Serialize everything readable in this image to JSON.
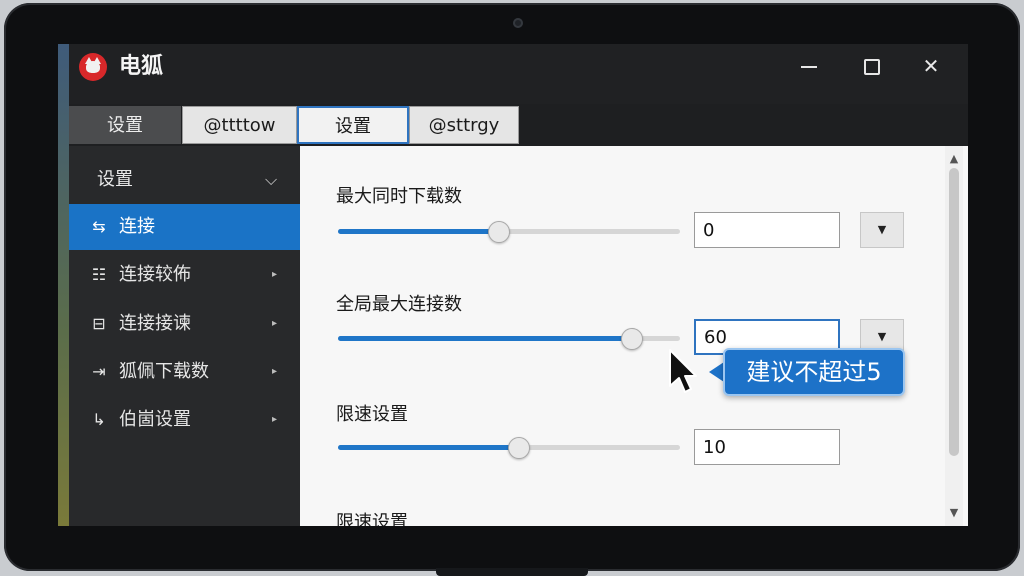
{
  "window": {
    "app_title": "电狐",
    "logo": "fox-logo",
    "controls": [
      "minimize-icon",
      "maximize-icon",
      "close-icon"
    ],
    "close_glyph": "✕"
  },
  "tabs": [
    {
      "label": "设置",
      "state": "dark"
    },
    {
      "label": "@ttttow",
      "state": "normal"
    },
    {
      "label": "设置",
      "state": "selected"
    },
    {
      "label": "@sttrgy",
      "state": "normal"
    }
  ],
  "sidebar": {
    "header": {
      "label": "设置",
      "chevron": "⌵"
    },
    "items": [
      {
        "label": "连接",
        "icon": "connection-icon",
        "glyph": "⇆",
        "active": true
      },
      {
        "label": "连接较佈",
        "icon": "list-icon",
        "glyph": "☷",
        "arrow": "▸"
      },
      {
        "label": "连接接谏",
        "icon": "box-icon",
        "glyph": "⊟",
        "arrow": "▸"
      },
      {
        "label": "狐佩下载数",
        "icon": "export-icon",
        "glyph": "⇥",
        "arrow": "▸"
      },
      {
        "label": "伯崮设置",
        "icon": "redirect-icon",
        "glyph": "↳",
        "arrow": "▸"
      }
    ]
  },
  "content": {
    "sections": [
      {
        "title": "最大同时下载数",
        "value": "0",
        "slider_fraction": 0.47,
        "has_dropdown": true
      },
      {
        "title": "全局最大连接数",
        "value": "60",
        "slider_fraction": 0.86,
        "has_dropdown": true
      },
      {
        "title": "限速设置",
        "value": "10",
        "slider_fraction": 0.53,
        "has_dropdown": false
      },
      {
        "title": "限速设置"
      }
    ],
    "dropdown_glyph": "▼"
  },
  "tooltip": {
    "text": "建议不超过5"
  },
  "colors": {
    "accent": "#1f76c8",
    "sidebar_bg": "#28292b",
    "titlebar_bg": "#202123",
    "content_bg": "#f7f7f7",
    "tooltip_bg": "#1d72c8"
  }
}
